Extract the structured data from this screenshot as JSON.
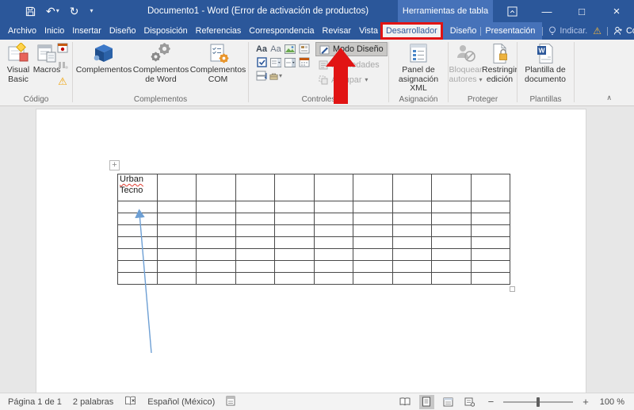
{
  "colors": {
    "title_bar_blue": "#2b579a",
    "contextual_tab_blue": "#4672b9",
    "ribbon_bg": "#f1f1f1",
    "annotation_red": "#e11414",
    "annotation_arrow_blue": "#6d9fd4",
    "warning_orange": "#f0a822",
    "table_border": "#4a4a4a"
  },
  "titlebar": {
    "title": "Documento1 - Word (Error de activación de productos)",
    "contextual_label": "Herramientas de tabla"
  },
  "icons": {
    "undo": "↶",
    "redo": "↻",
    "dropdown": "▾",
    "minimize": "—",
    "restore": "□",
    "close": "×",
    "warning": "⚠",
    "collapse_ribbon": "∧",
    "zoom_out": "−",
    "zoom_in": "+",
    "rich_text": "Aa",
    "plain_text": "Aa",
    "table_move": "+",
    "word_logo": "W"
  },
  "tabs": {
    "main": [
      "Archivo",
      "Inicio",
      "Insertar",
      "Diseño",
      "Disposición",
      "Referencias",
      "Correspondencia",
      "Revisar",
      "Vista",
      "Desarrollador"
    ],
    "active": "Desarrollador",
    "contextual": [
      "Diseño",
      "Presentación"
    ],
    "tell_me": "Indicar.",
    "share": "Compartir"
  },
  "ribbon": {
    "codigo": {
      "label": "Código",
      "visual_basic": "Visual Basic",
      "macros": "Macros"
    },
    "complementos": {
      "label": "Complementos",
      "complementos": "Complementos",
      "de_word": "Complementos de Word",
      "com": "Complementos COM"
    },
    "controles": {
      "label": "Controles",
      "modo_diseno": "Modo Diseño",
      "propiedades": "Propiedades",
      "agrupar": "Agrupar"
    },
    "asignacion": {
      "label": "Asignación",
      "panel": "Panel de asignación XML"
    },
    "proteger": {
      "label": "Proteger",
      "bloquear": "Bloquear autores",
      "restringir": "Restringir edición"
    },
    "plantillas": {
      "label": "Plantillas",
      "plantilla": "Plantilla de documento"
    }
  },
  "document": {
    "table": {
      "rows": 8,
      "cols": 10,
      "first_cell_lines": [
        "Urban",
        "Tecno"
      ]
    }
  },
  "statusbar": {
    "page_info": "Página 1 de 1",
    "word_count": "2 palabras",
    "language": "Español (México)",
    "zoom_level": "100 %"
  }
}
